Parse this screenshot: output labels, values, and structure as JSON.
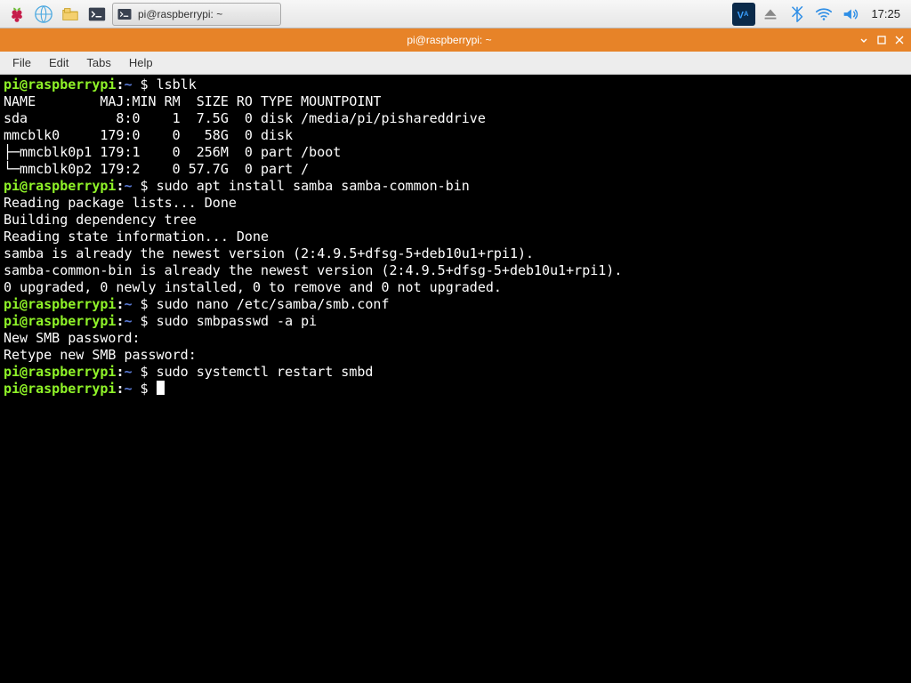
{
  "taskbar": {
    "app_task_label": "pi@raspberrypi: ~",
    "clock": "17:25"
  },
  "window": {
    "title": "pi@raspberrypi: ~"
  },
  "menu": {
    "file": "File",
    "edit": "Edit",
    "tabs": "Tabs",
    "help": "Help"
  },
  "prompt": {
    "user_host": "pi@raspberrypi",
    "sep": ":",
    "path": "~",
    "dollar": " $ "
  },
  "lines": {
    "cmd_lsblk": "lsblk",
    "hdr": "NAME        MAJ:MIN RM  SIZE RO TYPE MOUNTPOINT",
    "sda": "sda           8:0    1  7.5G  0 disk /media/pi/pishareddrive",
    "mmc0": "mmcblk0     179:0    0   58G  0 disk ",
    "mmc0p1": "├─mmcblk0p1 179:1    0  256M  0 part /boot",
    "mmc0p2": "└─mmcblk0p2 179:2    0 57.7G  0 part /",
    "cmd_apt": "sudo apt install samba samba-common-bin",
    "read_pkg": "Reading package lists... Done",
    "build_dep": "Building dependency tree       ",
    "read_state": "Reading state information... Done",
    "samba_ver": "samba is already the newest version (2:4.9.5+dfsg-5+deb10u1+rpi1).",
    "sambabin_ver": "samba-common-bin is already the newest version (2:4.9.5+dfsg-5+deb10u1+rpi1).",
    "upgraded": "0 upgraded, 0 newly installed, 0 to remove and 0 not upgraded.",
    "cmd_nano": "sudo nano /etc/samba/smb.conf",
    "cmd_smbpw": "sudo smbpasswd -a pi",
    "newsmb": "New SMB password:",
    "retype": "Retype new SMB password:",
    "cmd_restart": "sudo systemctl restart smbd"
  }
}
